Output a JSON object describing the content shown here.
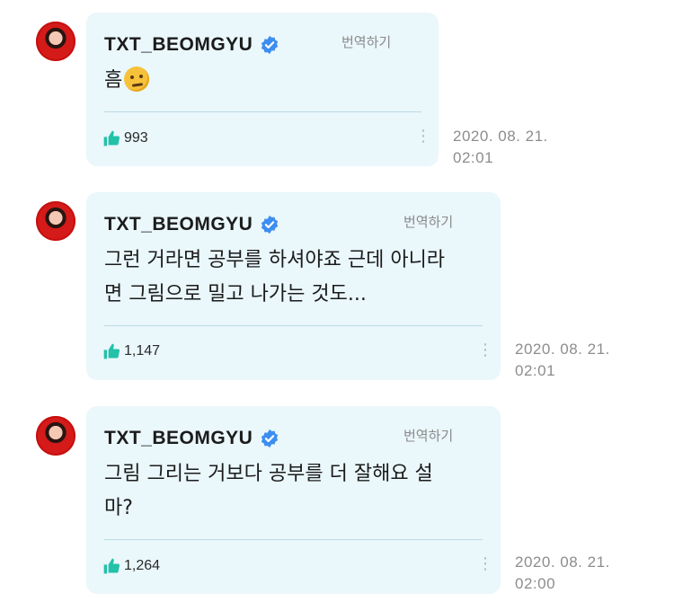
{
  "posts": [
    {
      "author": "TXT_BEOMGYU",
      "translate_label": "번역하기",
      "text_line1": "흠",
      "text_line2": "",
      "emoji": "thinking-face",
      "likes": "993",
      "date": "2020. 08. 21.",
      "time": "02:01"
    },
    {
      "author": "TXT_BEOMGYU",
      "translate_label": "번역하기",
      "text_line1": "그런 거라면 공부를 하셔야죠 근데 아니라",
      "text_line2": "면 그림으로 밀고 나가는 것도...",
      "likes": "1,147",
      "date": "2020. 08. 21.",
      "time": "02:01"
    },
    {
      "author": "TXT_BEOMGYU",
      "translate_label": "번역하기",
      "text_line1": "그림 그리는 거보다 공부를 더 잘해요 설",
      "text_line2": "마?",
      "likes": "1,264",
      "date": "2020. 08. 21.",
      "time": "02:00"
    }
  ],
  "colors": {
    "bubble_bg": "#eaf7fb",
    "like_icon": "#22c1a8",
    "verified": "#3d8ef0"
  }
}
